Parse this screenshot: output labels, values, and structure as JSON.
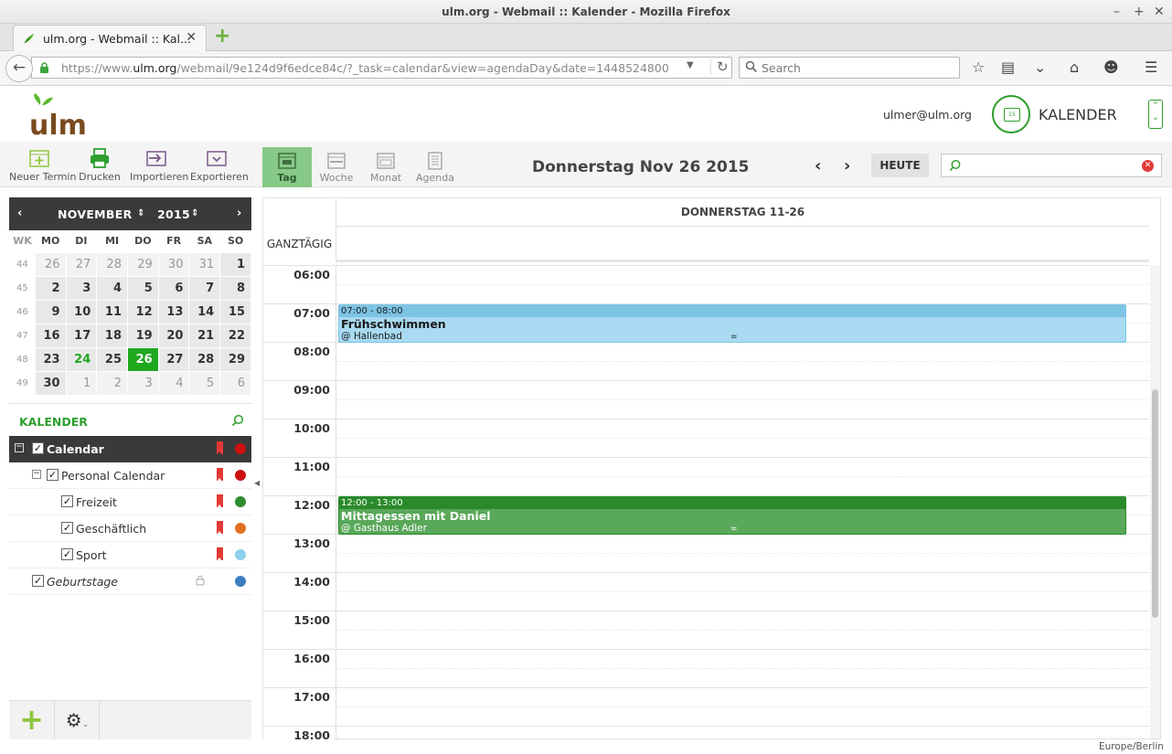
{
  "window": {
    "title": "ulm.org - Webmail :: Kalender - Mozilla Firefox"
  },
  "tab": {
    "label": "ulm.org - Webmail :: Kal..."
  },
  "nav": {
    "url_prefix": "https://www.",
    "url_domain": "ulm.org",
    "url_rest": "/webmail/9e124d9f6edce84c/?_task=calendar&view=agendaDay&date=1448524800",
    "search_placeholder": "Search"
  },
  "header": {
    "user": "ulmer@ulm.org",
    "task_label": "KALENDER",
    "task_icon_text": "15"
  },
  "toolbar": {
    "new_event": "Neuer Termin",
    "print": "Drucken",
    "import": "Importieren",
    "export": "Exportieren",
    "views": [
      "Tag",
      "Woche",
      "Monat",
      "Agenda"
    ],
    "date_title": "Donnerstag Nov 26 2015",
    "today": "HEUTE"
  },
  "minical": {
    "month": "NOVEMBER",
    "year": "2015",
    "headers": [
      "WK",
      "MO",
      "DI",
      "MI",
      "DO",
      "FR",
      "SA",
      "SO"
    ],
    "weeks": [
      {
        "wk": "44",
        "days": [
          "26",
          "27",
          "28",
          "29",
          "30",
          "31",
          "1"
        ]
      },
      {
        "wk": "45",
        "days": [
          "2",
          "3",
          "4",
          "5",
          "6",
          "7",
          "8"
        ]
      },
      {
        "wk": "46",
        "days": [
          "9",
          "10",
          "11",
          "12",
          "13",
          "14",
          "15"
        ]
      },
      {
        "wk": "47",
        "days": [
          "16",
          "17",
          "18",
          "19",
          "20",
          "21",
          "22"
        ]
      },
      {
        "wk": "48",
        "days": [
          "23",
          "24",
          "25",
          "26",
          "27",
          "28",
          "29"
        ]
      },
      {
        "wk": "49",
        "days": [
          "30",
          "1",
          "2",
          "3",
          "4",
          "5",
          "6"
        ]
      }
    ]
  },
  "calendars": {
    "heading": "KALENDER",
    "items": [
      {
        "name": "Calendar",
        "color": "#cc1111"
      },
      {
        "name": "Personal Calendar",
        "color": "#cc1111"
      },
      {
        "name": "Freizeit",
        "color": "#2e8b2e"
      },
      {
        "name": "Geschäftlich",
        "color": "#e07020"
      },
      {
        "name": "Sport",
        "color": "#8fd0ee"
      },
      {
        "name": "Geburtstage",
        "color": "#3d7cc0"
      }
    ]
  },
  "dayview": {
    "column_header": "DONNERSTAG 11-26",
    "allday_label": "GANZTÄGIG",
    "hours": [
      "06:00",
      "07:00",
      "08:00",
      "09:00",
      "10:00",
      "11:00",
      "12:00",
      "13:00",
      "14:00",
      "15:00",
      "16:00",
      "17:00",
      "18:00"
    ],
    "events": [
      {
        "time": "07:00 - 08:00",
        "title": "Frühschwimmen",
        "location": "@ Hallenbad",
        "head_color": "#7dc4e4",
        "body_color": "#a8daf1",
        "text_color": "#1a1a1a"
      },
      {
        "time": "12:00 - 13:00",
        "title": "Mittagessen mit Daniel",
        "location": "@ Gasthaus Adler",
        "head_color": "#2a8a2a",
        "body_color": "#5aa85a",
        "text_color": "#ffffff"
      }
    ]
  },
  "statusbar": {
    "timezone": "Europe/Berlin"
  }
}
